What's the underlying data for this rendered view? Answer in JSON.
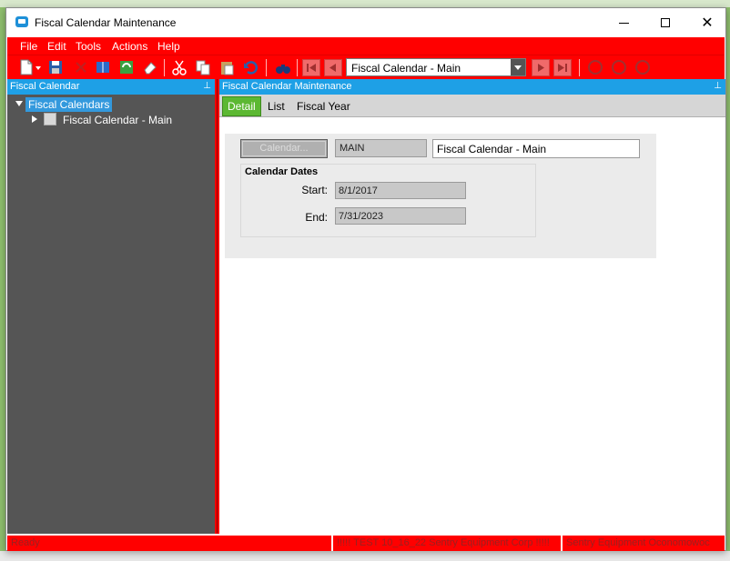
{
  "window": {
    "title": "Fiscal Calendar Maintenance"
  },
  "menu": {
    "items": [
      "File",
      "Edit",
      "Tools",
      "Actions",
      "Help"
    ]
  },
  "toolbar": {
    "record_selector": "Fiscal Calendar - Main"
  },
  "tree_panel": {
    "header": "Fiscal Calendar",
    "root_label": "Fiscal Calendars",
    "child_label": "Fiscal Calendar - Main"
  },
  "main_panel": {
    "header": "Fiscal Calendar Maintenance",
    "tabs": [
      {
        "label": "Detail",
        "active": true
      },
      {
        "label": "List",
        "active": false
      },
      {
        "label": "Fiscal Year",
        "active": false
      }
    ],
    "calendar_button_label": "Calendar...",
    "calendar_code": "MAIN",
    "calendar_description": "Fiscal Calendar - Main",
    "dates_group_title": "Calendar Dates",
    "start_label": "Start:",
    "start_value": "8/1/2017",
    "end_label": "End:",
    "end_value": "7/31/2023"
  },
  "status": {
    "left": "Ready",
    "middle": "!!!!!  TEST 10_16_22 Sentry Equipment Corp !!!!!",
    "right": "Sentry Equipment Oconomowoc"
  },
  "colors": {
    "accent": "#ff0000",
    "header": "#1ea0e6",
    "active_tab": "#5cb832",
    "tree_bg": "#555555"
  }
}
